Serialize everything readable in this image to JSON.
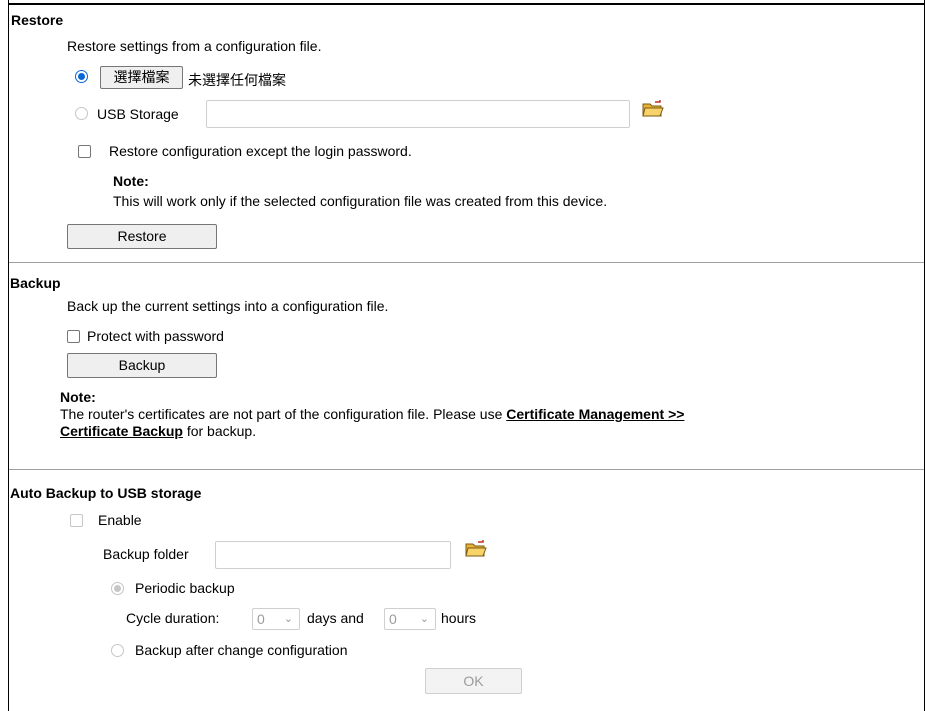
{
  "restore": {
    "heading": "Restore",
    "description": "Restore settings from a configuration file.",
    "choose_file_button": "選擇檔案",
    "no_file_text": "未選擇任何檔案",
    "usb_storage_label": "USB Storage",
    "usb_storage_value": "",
    "except_password_label": "Restore configuration except the login password.",
    "note_title": "Note:",
    "note_text": "This will work only if the selected configuration file was created from this device.",
    "restore_button": "Restore"
  },
  "backup": {
    "heading": "Backup",
    "description": "Back up the current settings into a configuration file.",
    "protect_label": "Protect with password",
    "backup_button": "Backup",
    "note_title": "Note:",
    "note_text_before": "The router's certificates are not part of the configuration file. Please use ",
    "note_link_line1": "Certificate Management >>",
    "note_link_line2": "Certificate Backup",
    "note_text_after": " for backup."
  },
  "auto_backup": {
    "heading": "Auto Backup to USB storage",
    "enable_label": "Enable",
    "folder_label": "Backup folder",
    "folder_value": "",
    "periodic_label": "Periodic backup",
    "cycle_label": "Cycle duration:",
    "days_value": "0",
    "days_text": "days and",
    "hours_value": "0",
    "hours_text": "hours",
    "after_change_label": "Backup after change configuration",
    "ok_button": "OK"
  },
  "colors": {
    "radio_selected": "#0a66d8",
    "disabled_gray": "#9b9b9b",
    "separator": "#a0a0a0"
  }
}
